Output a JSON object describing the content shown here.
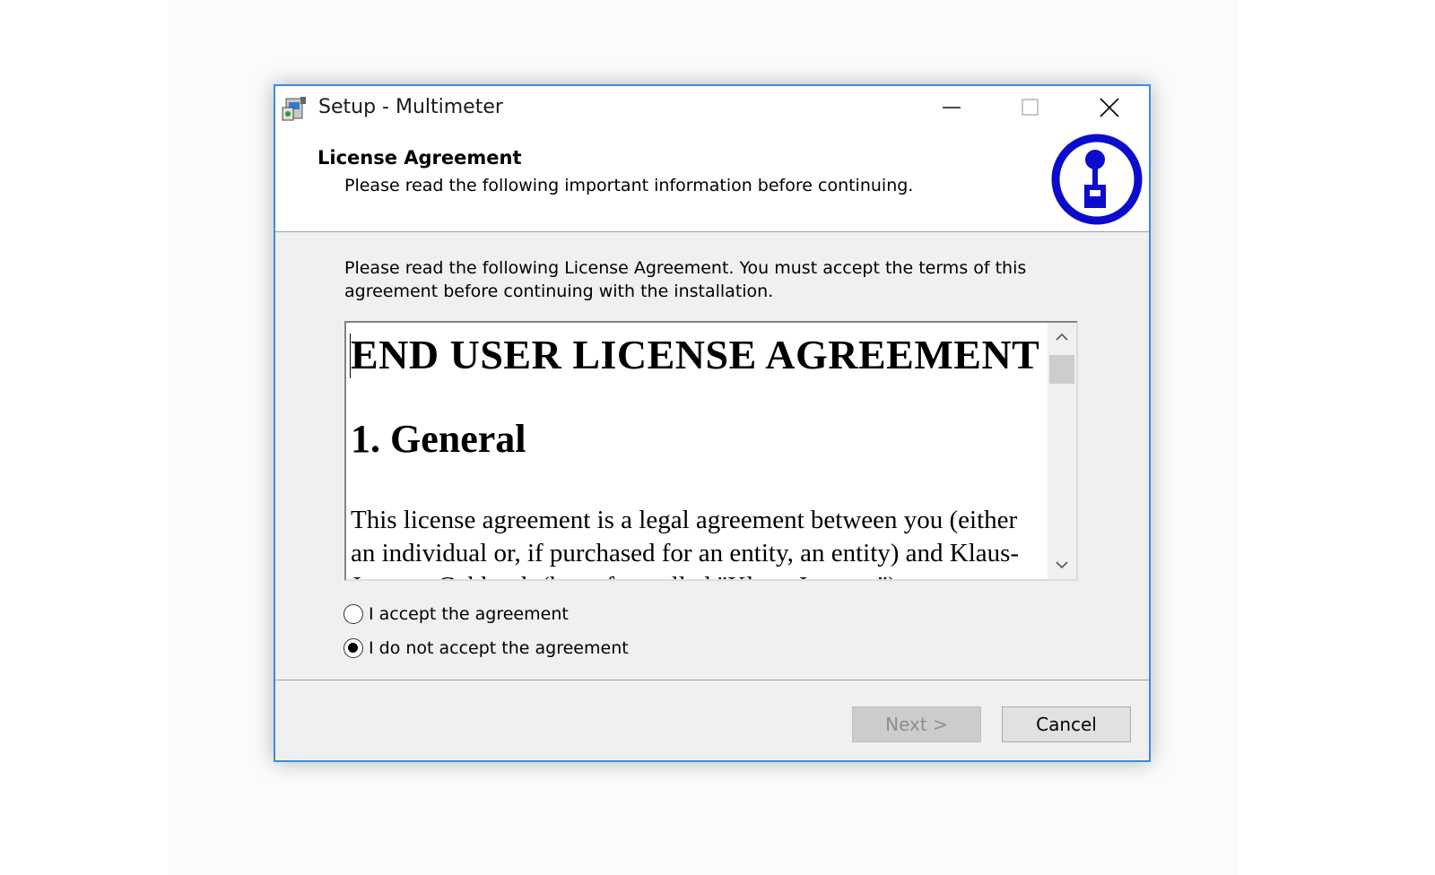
{
  "window": {
    "title": "Setup - Multimeter",
    "icons": {
      "app": "setup-installer-icon",
      "minimize": "minimize-icon",
      "maximize": "maximize-icon",
      "close": "close-icon"
    }
  },
  "header": {
    "title": "License Agreement",
    "subtitle": "Please read the following important information before continuing.",
    "logo": "multimeter-logo-icon"
  },
  "intro": {
    "line1": "Please read the following License Agreement. You must accept the terms of this",
    "line2": "agreement before continuing with the installation."
  },
  "license": {
    "heading": "END USER LICENSE AGREEMENT",
    "section": "1. General",
    "paragraph": "This license agreement is a legal agreement between you (either an individual or, if purchased for an entity, an entity) and Klaus-Juergen Gebhardt (hereafter called \"Klaus-Juergen\")"
  },
  "options": {
    "accept": {
      "label": "I accept the agreement",
      "checked": false
    },
    "decline": {
      "label": "I do not accept the agreement",
      "checked": true
    }
  },
  "buttons": {
    "next": "Next >",
    "cancel": "Cancel"
  },
  "colors": {
    "window_border": "#3c8ce0",
    "logo_blue": "#0c0ccc",
    "disabled_text": "#8d8d8d"
  }
}
